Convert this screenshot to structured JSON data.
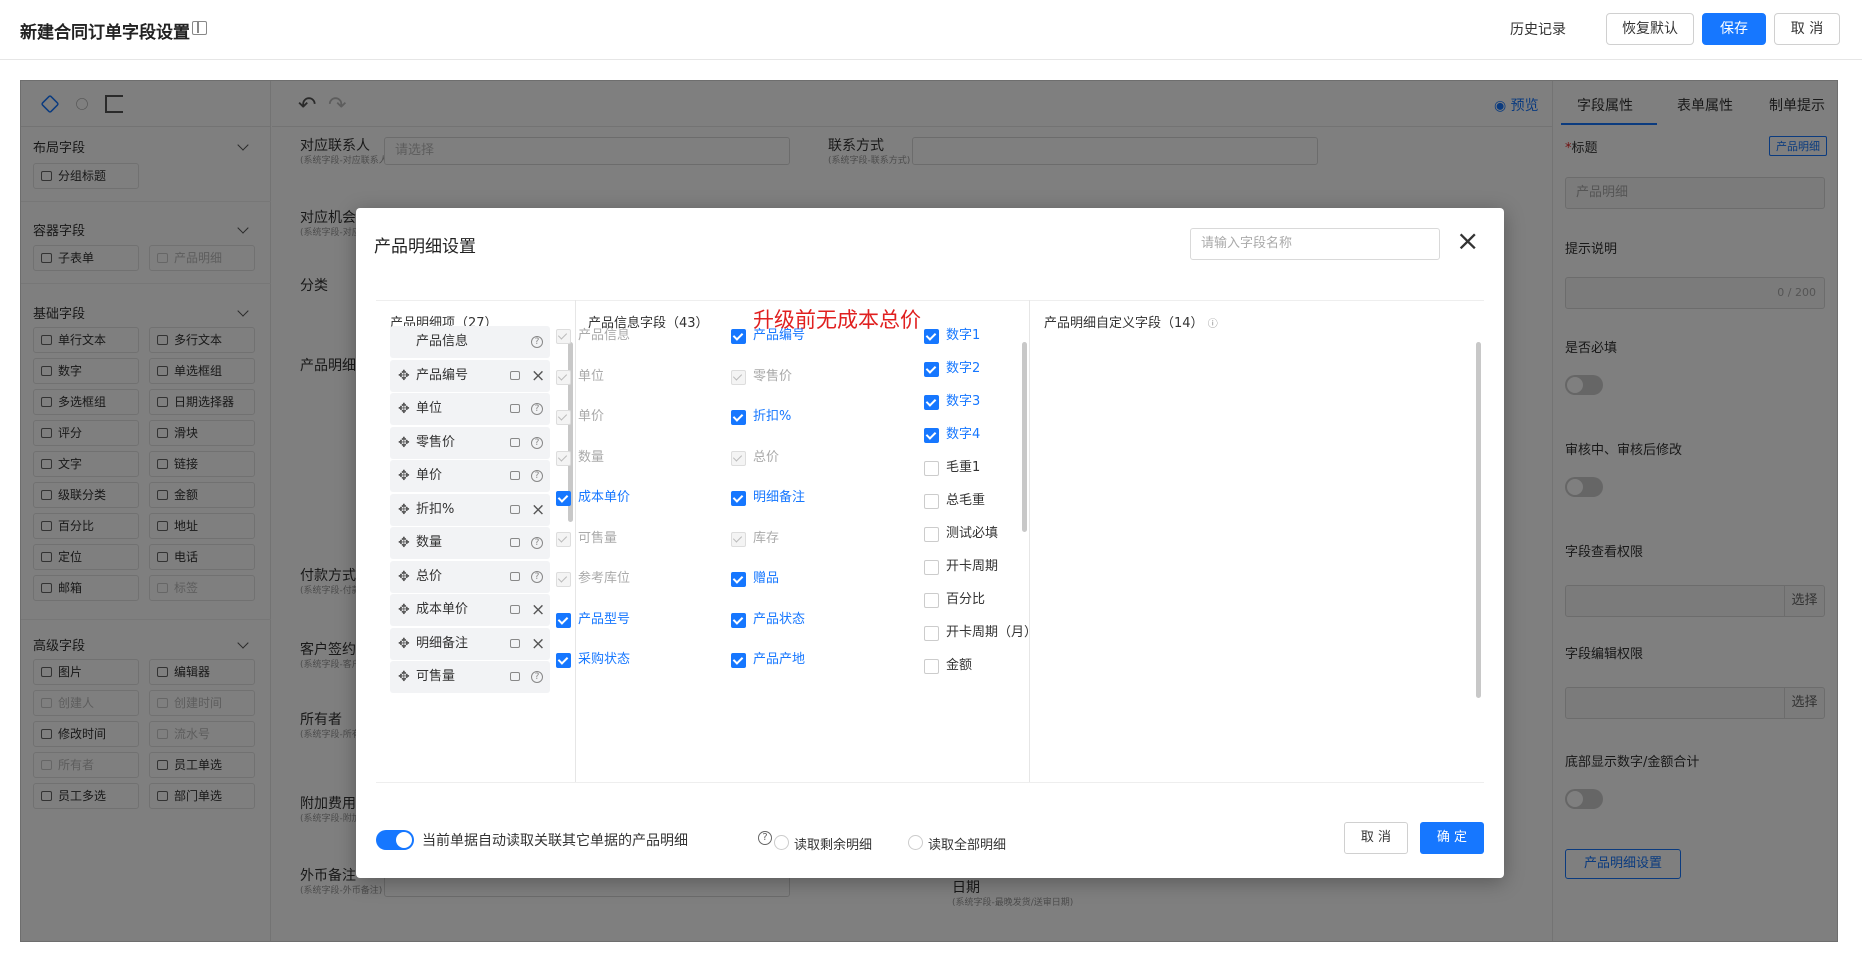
{
  "topbar": {
    "title": "新建合同订单字段设置",
    "history": "历史记录",
    "restore": "恢复默认",
    "save": "保存",
    "cancel": "取 消"
  },
  "left": {
    "sections": [
      "布局字段",
      "容器字段",
      "基础字段",
      "高级字段"
    ],
    "layout": [
      "分组标题"
    ],
    "container": [
      "子表单",
      "产品明细"
    ],
    "basic": [
      "单行文本",
      "多行文本",
      "数字",
      "单选框组",
      "多选框组",
      "日期选择器",
      "评分",
      "滑块",
      "文字",
      "链接",
      "级联分类",
      "金额",
      "百分比",
      "地址",
      "定位",
      "电话",
      "邮箱",
      "标签"
    ],
    "advanced": [
      "图片",
      "编辑器",
      "创建人",
      "创建时间",
      "修改时间",
      "流水号",
      "所有者",
      "员工单选",
      "员工多选",
      "部门单选"
    ]
  },
  "mid": {
    "preview": "预览",
    "fields": [
      {
        "label": "对应联系人",
        "sub": "(系统字段-对应联系人)",
        "placeholder": "请选择"
      },
      {
        "label": "联系方式",
        "sub": "(系统字段-联系方式)"
      },
      {
        "label": "对应机会",
        "sub": "(系统字段-对应机会)"
      },
      {
        "label": "分类",
        "sub": ""
      },
      {
        "label": "产品明细",
        "sub": ""
      },
      {
        "label": "付款方式",
        "sub": "(系统字段-付款方式)"
      },
      {
        "label": "客户签约人",
        "sub": "(系统字段-客户签约人)"
      },
      {
        "label": "所有者",
        "sub": "(系统字段-所有者)"
      },
      {
        "label": "附加费用",
        "sub": "(系统字段-附加费用)"
      },
      {
        "label": "外币备注",
        "sub": "(系统字段-外币备注)"
      },
      {
        "label": "日期",
        "sub": "(系统字段-最晚发货/送审日期)"
      }
    ]
  },
  "right": {
    "tabs": [
      "字段属性",
      "表单属性",
      "制单提示"
    ],
    "title_label": "标题",
    "title_tag": "产品明细",
    "title_value": "产品明细",
    "hint_label": "提示说明",
    "hint_count": "0 / 200",
    "required_label": "是否必填",
    "audit_label": "审核中、审核后修改",
    "view_perm_label": "字段查看权限",
    "edit_perm_label": "字段编辑权限",
    "select": "选择",
    "sum_label": "底部显示数字/金额合计",
    "settings_button": "产品明细设置"
  },
  "modal": {
    "title": "产品明细设置",
    "search_placeholder": "请输入字段名称",
    "col1_title": "产品明细项（27）",
    "col2_title": "产品信息字段（43）",
    "col3_title": "产品明细自定义字段（14）",
    "annotation": "升级前无成本总价",
    "items": [
      {
        "label": "产品信息",
        "action": "q",
        "drag": false
      },
      {
        "label": "产品编号",
        "action": "x",
        "drag": true
      },
      {
        "label": "单位",
        "action": "q",
        "drag": true
      },
      {
        "label": "零售价",
        "action": "q",
        "drag": true
      },
      {
        "label": "单价",
        "action": "q",
        "drag": true
      },
      {
        "label": "折扣%",
        "action": "x",
        "drag": true
      },
      {
        "label": "数量",
        "action": "q",
        "drag": true
      },
      {
        "label": "总价",
        "action": "q",
        "drag": true
      },
      {
        "label": "成本单价",
        "action": "x",
        "drag": true
      },
      {
        "label": "明细备注",
        "action": "x",
        "drag": true
      },
      {
        "label": "可售量",
        "action": "q",
        "drag": true
      }
    ],
    "info_fields": [
      {
        "label": "产品信息",
        "state": "dis"
      },
      {
        "label": "产品编号",
        "state": "on"
      },
      {
        "label": "单位",
        "state": "dis"
      },
      {
        "label": "零售价",
        "state": "dis"
      },
      {
        "label": "单价",
        "state": "dis"
      },
      {
        "label": "折扣%",
        "state": "on"
      },
      {
        "label": "数量",
        "state": "dis"
      },
      {
        "label": "总价",
        "state": "dis"
      },
      {
        "label": "成本单价",
        "state": "on"
      },
      {
        "label": "明细备注",
        "state": "on"
      },
      {
        "label": "可售量",
        "state": "dis"
      },
      {
        "label": "库存",
        "state": "dis"
      },
      {
        "label": "参考库位",
        "state": "dis"
      },
      {
        "label": "赠品",
        "state": "on"
      },
      {
        "label": "产品型号",
        "state": "on"
      },
      {
        "label": "产品状态",
        "state": "on"
      },
      {
        "label": "采购状态",
        "state": "on"
      },
      {
        "label": "产品产地",
        "state": "on"
      }
    ],
    "custom_fields": [
      {
        "label": "数字1",
        "state": "on"
      },
      {
        "label": "数字2",
        "state": "on"
      },
      {
        "label": "数字3",
        "state": "on"
      },
      {
        "label": "数字4",
        "state": "on"
      },
      {
        "label": "毛重1",
        "state": "off"
      },
      {
        "label": "总毛重",
        "state": "off"
      },
      {
        "label": "测试必填",
        "state": "off"
      },
      {
        "label": "开卡周期",
        "state": "off"
      },
      {
        "label": "百分比",
        "state": "off"
      },
      {
        "label": "开卡周期（月）",
        "state": "off"
      },
      {
        "label": "金额",
        "state": "off"
      }
    ],
    "auto_read_label": "当前单据自动读取关联其它单据的产品明细",
    "radio_remaining": "读取剩余明细",
    "radio_all": "读取全部明细",
    "cancel": "取 消",
    "confirm": "确 定"
  }
}
